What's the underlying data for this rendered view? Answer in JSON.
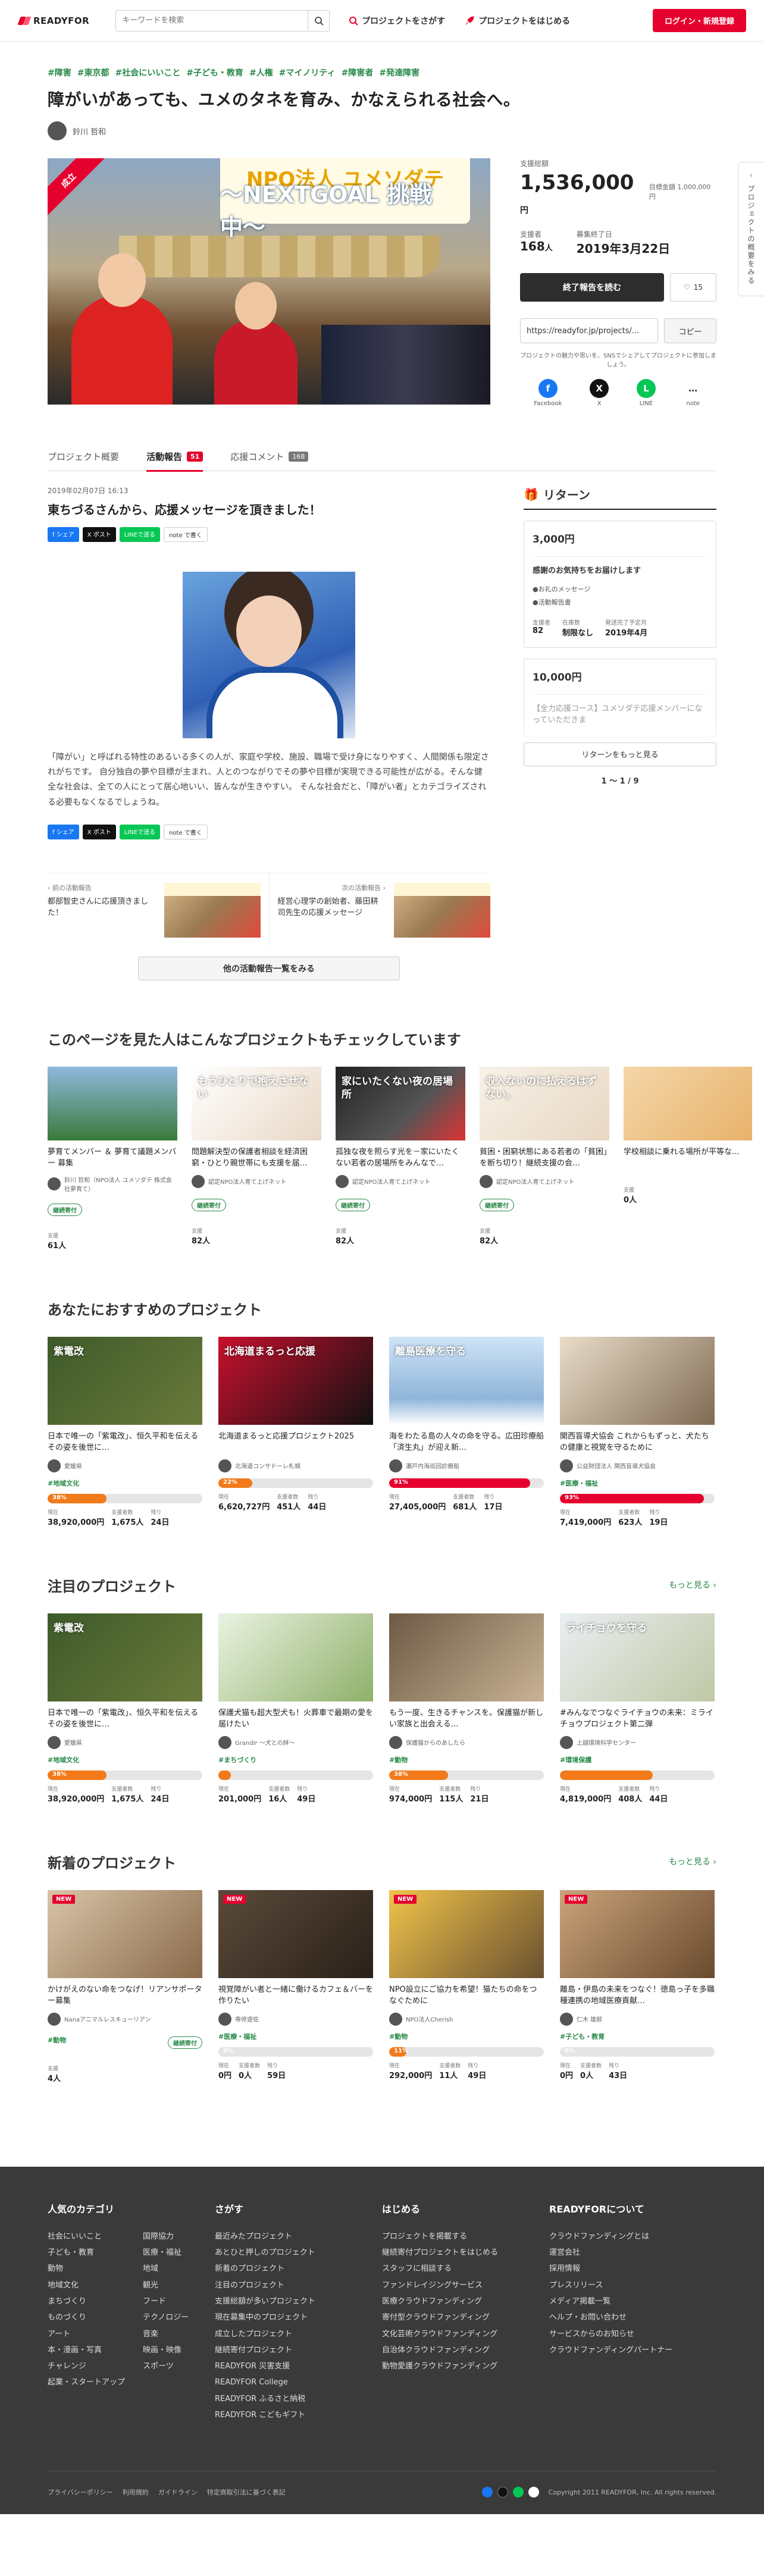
{
  "header": {
    "logo": "READYFOR",
    "search_placeholder": "キーワードを検索",
    "find_project": "プロジェクトをさがす",
    "start_project": "プロジェクトをはじめる",
    "login": "ログイン・新規登録"
  },
  "sidetab": "プロジェクトの概要をみる",
  "project": {
    "tags": [
      "#障害",
      "#東京都",
      "#社会にいいこと",
      "#子ども・教育",
      "#人権",
      "#マイノリティ",
      "#障害者",
      "#発達障害"
    ],
    "title": "障がいがあっても、ユメのタネを育み、かなえられる社会へ。",
    "owner": "鈴川 哲和",
    "ribbon": "成立",
    "banner_top": "NPO法人 ユメソダテ",
    "banner_sub": "〜NEXTGOAL 挑戦中〜",
    "raised_label": "支援総額",
    "raised": "1,536,000",
    "yen": "円",
    "goal": "目標金額 1,000,000円",
    "supporters_label": "支援者",
    "supporters": "168",
    "person": "人",
    "end_label": "募集終了日",
    "end": "2019年3月22日",
    "btn_end": "終了報告を読む",
    "fav_count": "15",
    "url": "https://readyfor.jp/projects/...",
    "copy": "コピー",
    "share_note": "プロジェクトの魅力や思いを、SNSでシェアしてプロジェクトに参加しましょう。",
    "sns": [
      {
        "label": "Facebook",
        "color": "#1877f2",
        "g": "f"
      },
      {
        "label": "X",
        "color": "#111111",
        "g": "X"
      },
      {
        "label": "LINE",
        "color": "#06c755",
        "g": "L"
      },
      {
        "label": "note",
        "color": "#ffffff",
        "g": "…"
      }
    ]
  },
  "tabs": [
    {
      "label": "プロジェクト概要",
      "badge": ""
    },
    {
      "label": "活動報告",
      "badge": "51"
    },
    {
      "label": "応援コメント",
      "badge": "168"
    }
  ],
  "report": {
    "date": "2019年02月07日 16:13",
    "title": "東ちづるさんから、応援メッセージを頂きました！",
    "share": [
      "f シェア",
      "X ポスト",
      "LINEで送る",
      "note で書く"
    ],
    "body": "「障がい」と呼ばれる特性のあるいる多くの人が、家庭や学校、施設、職場で受け身になりやすく、人間関係も限定されがちです。 自分独自の夢や目標が主まれ、人とのつながりでその夢や目標が実現できる可能性が広がる。そんな健全な社会は、全ての人にとって居心地いい、皆んなが生きやすい。 そんな社会だと、「障がい者」とカテゴライズされる必要もなくなるでしょうね。",
    "prev_label": "前の活動報告",
    "prev_title": "都部智史さんに応援頂きました！",
    "next_label": "次の活動報告",
    "next_title": "経営心理学の創始者、藤田耕司先生の応援メッセージ",
    "all_btn": "他の活動報告一覧をみる"
  },
  "returns": {
    "heading": "リターン",
    "card1": {
      "price": "3,000円",
      "desc": "感謝のお気持ちをお届けします",
      "items": [
        "●お礼のメッセージ",
        "●活動報告書"
      ],
      "m1l": "支援者",
      "m1": "82",
      "m2l": "在庫数",
      "m2": "制限なし",
      "m3l": "発送完了予定月",
      "m3": "2019年4月"
    },
    "card2": {
      "price": "10,000円",
      "desc": "【全力応援コース】ユメソダテ応援メンバーになっていただきま"
    },
    "more": "リターンをもっと見る",
    "pager": "1 〜 1 / 9"
  },
  "sec_viewed": {
    "title": "このページを見た人はこんなプロジェクトもチェックしています",
    "cards": [
      {
        "t": "夢育てメンバー ＆ 夢育て議題メンバー 募集",
        "org": "鈴川 哲和（NPO法人 ユメソダテ 株式会社夢育て）",
        "tag": "継続寄付",
        "label": "支援",
        "val": "61人",
        "bg": "linear-gradient(180deg,#8fb8de,#3a7a3a)"
      },
      {
        "t": "問題解決型の保護者相談を経済困窮・ひとり親世帯にも支援を届…",
        "org": "認定NPO法人育て上げネット",
        "tag": "継続寄付",
        "label": "支援",
        "val": "82人",
        "bg": "linear-gradient(135deg,#fff,#e9d8c6)",
        "txt": "もうひとりで抱えさせない"
      },
      {
        "t": "孤独な夜を照らす光を－家にいたくない若者の居場所をみんなで…",
        "org": "認定NPO法人育て上げネット",
        "tag": "継続寄付",
        "label": "支援",
        "val": "82人",
        "bg": "linear-gradient(135deg,#222,#555 60%,#d33)",
        "txt": "家にいたくない夜の居場所"
      },
      {
        "t": "貧困・困窮状態にある若者の「貧困」を断ち切り！継続支援の会…",
        "org": "認定NPO法人育て上げネット",
        "tag": "継続寄付",
        "label": "支援",
        "val": "82人",
        "bg": "linear-gradient(135deg,#f7f2e8,#e8d7c3)",
        "txt": "収入ないのに払えるはずない。"
      },
      {
        "t": "学校相談に乗れる場所が平等な…",
        "org": "",
        "tag": "",
        "label": "支援",
        "val": "0人",
        "bg": "linear-gradient(135deg,#f4d6a8,#e8b26a)"
      }
    ]
  },
  "sec_reco": {
    "title": "あなたにおすすめのプロジェクト",
    "cards": [
      {
        "t": "日本で唯一の「紫電改」、恒久平和を伝えるその姿を後世に…",
        "org": "愛媛県",
        "tag": "#地域文化",
        "pct": "38%",
        "w": 38,
        "v1": "38,920,000円",
        "v2": "1,675人",
        "v3": "24日",
        "bg": "linear-gradient(135deg,#3e5a2a,#6a7a3a)",
        "txt": "紫電改"
      },
      {
        "t": "北海道まるっと応援プロジェクト2025",
        "org": "北海道コンサドーレ札幌",
        "tag": "",
        "pct": "22%",
        "w": 22,
        "v1": "6,620,727円",
        "v2": "451人",
        "v3": "44日",
        "bg": "linear-gradient(135deg,#c8102e,#111)",
        "txt": "北海道まるっと応援"
      },
      {
        "t": "海をわたる島の人々の命を守る。広田珍療船「済生丸」が迎え新…",
        "org": "瀬戸内海巡回診療船",
        "tag": "",
        "pct": "91%",
        "w": 91,
        "v1": "27,405,000円",
        "v2": "681人",
        "v3": "17日",
        "bg": "linear-gradient(180deg,#cfe4f7,#8fb5d9 70%,#fff)",
        "txt": "離島医療を守る"
      },
      {
        "t": "関西盲導犬協会 これからもずっと、犬たちの健康と視覚を守るために",
        "org": "公益財団法人 関西盲導犬協会",
        "tag": "#医療・福祉",
        "pct": "93%",
        "w": 93,
        "v1": "7,419,000円",
        "v2": "623人",
        "v3": "19日",
        "bg": "linear-gradient(135deg,#e9ddc9,#7f6a52)",
        "txt": ""
      }
    ]
  },
  "sec_feat": {
    "title": "注目のプロジェクト",
    "more": "もっと見る",
    "cards": [
      {
        "t": "日本で唯一の「紫電改」、恒久平和を伝えるその姿を後世に…",
        "org": "愛媛県",
        "tag": "#地域文化",
        "pct": "38%",
        "w": 38,
        "v1": "38,920,000円",
        "v2": "1,675人",
        "v3": "24日",
        "bg": "linear-gradient(135deg,#3e5a2a,#6a7a3a)",
        "txt": "紫電改"
      },
      {
        "t": "保護犬猫も超大型犬も！火葬車で最期の愛を届けたい",
        "org": "Grandir 〜犬との絆〜",
        "tag": "#まちづくり",
        "pct": "",
        "w": 5,
        "v1": "201,000円",
        "v2": "16人",
        "v3": "49日",
        "bg": "linear-gradient(135deg,#eaf3e2,#8fb06a)",
        "txt": ""
      },
      {
        "t": "もう一度、生きるチャンスを。保護猫が新しい家族と出会える…",
        "org": "保護猫からのあしたら",
        "tag": "#動物",
        "pct": "38%",
        "w": 38,
        "v1": "974,000円",
        "v2": "115人",
        "v3": "21日",
        "bg": "linear-gradient(135deg,#6d5a45,#c9b394)",
        "txt": ""
      },
      {
        "t": "#みんなでつなぐライチョウの未来：ミライチョウプロジェクト第二弾",
        "org": "上越環境科学センター",
        "tag": "#環境保護",
        "pct": "",
        "w": 60,
        "v1": "4,819,000円",
        "v2": "408人",
        "v3": "44日",
        "bg": "linear-gradient(135deg,#e9eef2,#bfc9a6)",
        "txt": "ライチョウを守る"
      }
    ]
  },
  "sec_new": {
    "title": "新着のプロジェクト",
    "more": "もっと見る",
    "new_badge": "NEW",
    "cards": [
      {
        "t": "かけがえのない命をつなげ！リアンサポーター募集",
        "org": "Nanaアニマルレスキューリアン",
        "tag": "#動物",
        "kt": "継続寄付",
        "label": "支援",
        "val": "4人",
        "bg": "linear-gradient(135deg,#d9c4a8,#8a6a4a)"
      },
      {
        "t": "視覚障がい者と一緒に働けるカフェ＆バーを作りたい",
        "org": "専修遊佐",
        "tag": "#医療・福祉",
        "pct": "0%",
        "w": 0,
        "v1": "0円",
        "v2": "0人",
        "v3": "59日",
        "bg": "linear-gradient(135deg,#5a4a3a,#2a2018)",
        "txt": ""
      },
      {
        "t": "NPO設立にご協力を希望！猫たちの命をつなぐために",
        "org": "NPO法人Cherish",
        "tag": "#動物",
        "pct": "11%",
        "w": 11,
        "v1": "292,000円",
        "v2": "11人",
        "v3": "49日",
        "bg": "linear-gradient(135deg,#f0c34a,#6a5030)",
        "txt": ""
      },
      {
        "t": "離島・伊島の未来をつなぐ！徳島っ子を多職種連携の地域医療貢献…",
        "org": "仁木 雄郎",
        "tag": "#子ども・教育",
        "pct": "0%",
        "w": 0,
        "v1": "0円",
        "v2": "0人",
        "v3": "43日",
        "bg": "linear-gradient(135deg,#c9a37a,#6a4a2e)",
        "txt": ""
      }
    ]
  },
  "labels": {
    "v1": "現在",
    "v2": "支援者数",
    "v3": "残り"
  },
  "footer": {
    "cat_title": "人気のカテゴリ",
    "cat_a": [
      "社会にいいこと",
      "子ども・教育",
      "動物",
      "地域文化",
      "まちづくり",
      "ものづくり",
      "アート",
      "本・漫画・写真",
      "チャレンジ",
      "起業・スタートアップ"
    ],
    "cat_b": [
      "国際協力",
      "医療・福祉",
      "地域",
      "観光",
      "フード",
      "テクノロジー",
      "音楽",
      "映画・映像",
      "スポーツ"
    ],
    "find_title": "さがす",
    "find": [
      "最近みたプロジェクト",
      "あとひと押しのプロジェクト",
      "新着のプロジェクト",
      "注目のプロジェクト",
      "支援総額が多いプロジェクト",
      "現在募集中のプロジェクト",
      "成立したプロジェクト",
      "継続寄付プロジェクト",
      "READYFOR 災害支援",
      "READYFOR College",
      "READYFOR ふるさと納税",
      "READYFOR こどもギフト"
    ],
    "start_title": "はじめる",
    "start": [
      "プロジェクトを掲載する",
      "継続寄付プロジェクトをはじめる",
      "スタッフに相談する",
      "ファンドレイジングサービス",
      "医療クラウドファンディング",
      "寄付型クラウドファンディング",
      "文化芸術クラウドファンディング",
      "自治体クラウドファンディング",
      "動物愛護クラウドファンディング"
    ],
    "about_title": "READYFORについて",
    "about": [
      "クラウドファンディングとは",
      "運営会社",
      "採用情報",
      "プレスリリース",
      "メディア掲載一覧",
      "ヘルプ・お問い合わせ",
      "サービスからのお知らせ",
      "クラウドファンディングパートナー"
    ],
    "bottom": [
      "プライバシーポリシー",
      "利用規約",
      "ガイドライン",
      "特定商取引法に基づく表記"
    ],
    "copyright": "Copyright 2011 READYFOR, Inc. All rights reserved."
  }
}
